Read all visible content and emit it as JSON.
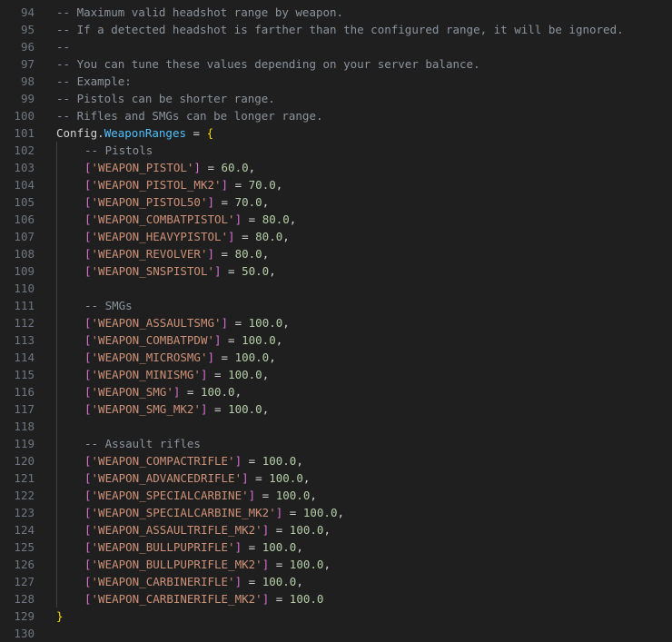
{
  "lines": [
    {
      "n": "94",
      "type": "comment",
      "text": "-- Maximum valid headshot range by weapon."
    },
    {
      "n": "95",
      "type": "comment",
      "text": "-- If a detected headshot is farther than the configured range, it will be ignored."
    },
    {
      "n": "96",
      "type": "comment",
      "text": "--"
    },
    {
      "n": "97",
      "type": "comment",
      "text": "-- You can tune these values depending on your server balance."
    },
    {
      "n": "98",
      "type": "comment",
      "text": "-- Example:"
    },
    {
      "n": "99",
      "type": "comment",
      "text": "-- Pistols can be shorter range."
    },
    {
      "n": "100",
      "type": "comment",
      "text": "-- Rifles and SMGs can be longer range."
    },
    {
      "n": "101",
      "type": "open",
      "obj": "Config",
      "dot": ".",
      "prop": "WeaponRanges",
      "eq": " = ",
      "brace": "{"
    },
    {
      "n": "102",
      "type": "icomment",
      "text": "-- Pistols"
    },
    {
      "n": "103",
      "type": "entry",
      "key": "'WEAPON_PISTOL'",
      "val": "60.0",
      "comma": ","
    },
    {
      "n": "104",
      "type": "entry",
      "key": "'WEAPON_PISTOL_MK2'",
      "val": "70.0",
      "comma": ","
    },
    {
      "n": "105",
      "type": "entry",
      "key": "'WEAPON_PISTOL50'",
      "val": "70.0",
      "comma": ","
    },
    {
      "n": "106",
      "type": "entry",
      "key": "'WEAPON_COMBATPISTOL'",
      "val": "80.0",
      "comma": ","
    },
    {
      "n": "107",
      "type": "entry",
      "key": "'WEAPON_HEAVYPISTOL'",
      "val": "80.0",
      "comma": ","
    },
    {
      "n": "108",
      "type": "entry",
      "key": "'WEAPON_REVOLVER'",
      "val": "80.0",
      "comma": ","
    },
    {
      "n": "109",
      "type": "entry",
      "key": "'WEAPON_SNSPISTOL'",
      "val": "50.0",
      "comma": ","
    },
    {
      "n": "110",
      "type": "blank"
    },
    {
      "n": "111",
      "type": "icomment",
      "text": "-- SMGs"
    },
    {
      "n": "112",
      "type": "entry",
      "key": "'WEAPON_ASSAULTSMG'",
      "val": "100.0",
      "comma": ","
    },
    {
      "n": "113",
      "type": "entry",
      "key": "'WEAPON_COMBATPDW'",
      "val": "100.0",
      "comma": ","
    },
    {
      "n": "114",
      "type": "entry",
      "key": "'WEAPON_MICROSMG'",
      "val": "100.0",
      "comma": ","
    },
    {
      "n": "115",
      "type": "entry",
      "key": "'WEAPON_MINISMG'",
      "val": "100.0",
      "comma": ","
    },
    {
      "n": "116",
      "type": "entry",
      "key": "'WEAPON_SMG'",
      "val": "100.0",
      "comma": ","
    },
    {
      "n": "117",
      "type": "entry",
      "key": "'WEAPON_SMG_MK2'",
      "val": "100.0",
      "comma": ","
    },
    {
      "n": "118",
      "type": "blank"
    },
    {
      "n": "119",
      "type": "icomment",
      "text": "-- Assault rifles"
    },
    {
      "n": "120",
      "type": "entry",
      "key": "'WEAPON_COMPACTRIFLE'",
      "val": "100.0",
      "comma": ","
    },
    {
      "n": "121",
      "type": "entry",
      "key": "'WEAPON_ADVANCEDRIFLE'",
      "val": "100.0",
      "comma": ","
    },
    {
      "n": "122",
      "type": "entry",
      "key": "'WEAPON_SPECIALCARBINE'",
      "val": "100.0",
      "comma": ","
    },
    {
      "n": "123",
      "type": "entry",
      "key": "'WEAPON_SPECIALCARBINE_MK2'",
      "val": "100.0",
      "comma": ","
    },
    {
      "n": "124",
      "type": "entry",
      "key": "'WEAPON_ASSAULTRIFLE_MK2'",
      "val": "100.0",
      "comma": ","
    },
    {
      "n": "125",
      "type": "entry",
      "key": "'WEAPON_BULLPUPRIFLE'",
      "val": "100.0",
      "comma": ","
    },
    {
      "n": "126",
      "type": "entry",
      "key": "'WEAPON_BULLPUPRIFLE_MK2'",
      "val": "100.0",
      "comma": ","
    },
    {
      "n": "127",
      "type": "entry",
      "key": "'WEAPON_CARBINERIFLE'",
      "val": "100.0",
      "comma": ","
    },
    {
      "n": "128",
      "type": "entry",
      "key": "'WEAPON_CARBINERIFLE_MK2'",
      "val": "100.0",
      "comma": ""
    },
    {
      "n": "129",
      "type": "close",
      "brace": "}"
    },
    {
      "n": "130",
      "type": "blank0"
    }
  ],
  "syntax": {
    "open_bracket": "[",
    "close_bracket": "]",
    "assign": " = "
  },
  "colors": {
    "background": "#1f1f1f",
    "line_number": "#6e7681",
    "comment": "#8b949e",
    "property": "#4fc1ff",
    "brace": "#ffd700",
    "bracket": "#da70d6",
    "string": "#ce9178",
    "number": "#b5cea8"
  }
}
